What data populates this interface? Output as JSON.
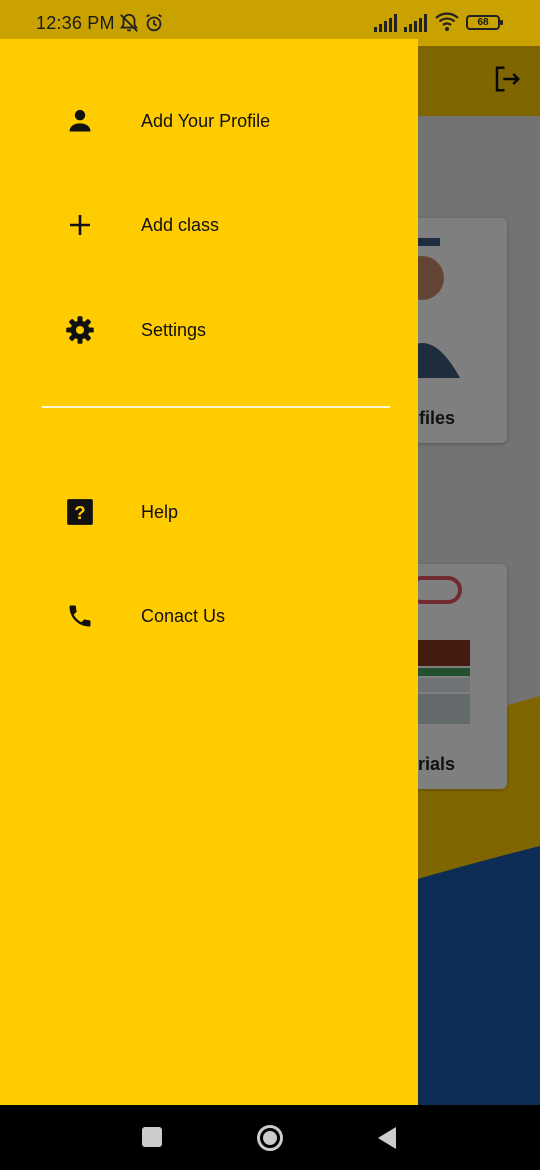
{
  "status_bar": {
    "time": "12:36 PM",
    "battery": "68"
  },
  "background": {
    "card1_label": "ofiles",
    "card2_label": "erials"
  },
  "drawer": {
    "items": [
      {
        "label": "Add Your Profile",
        "icon": "person-icon"
      },
      {
        "label": "Add class",
        "icon": "plus-icon"
      },
      {
        "label": "Settings",
        "icon": "gear-icon"
      },
      {
        "label": "Help",
        "icon": "help-icon"
      },
      {
        "label": "Conact Us",
        "icon": "phone-icon"
      }
    ]
  },
  "colors": {
    "drawer_bg": "#ffcc00",
    "status_bar_bg": "#c9a200"
  }
}
